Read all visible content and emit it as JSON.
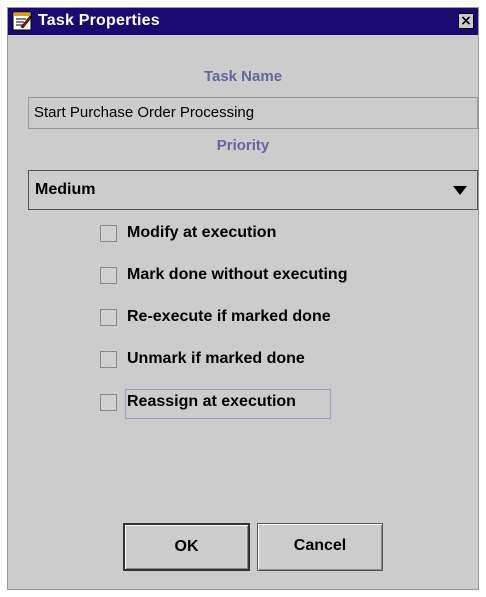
{
  "window": {
    "title": "Task Properties",
    "close_glyph": "×",
    "icon": "task-properties-icon"
  },
  "task_name": {
    "label": "Task Name",
    "value": "Start Purchase Order Processing"
  },
  "priority": {
    "label": "Priority",
    "selected": "Medium"
  },
  "options": [
    {
      "label": "Modify at execution",
      "checked": false
    },
    {
      "label": "Mark done without executing",
      "checked": false
    },
    {
      "label": "Re-execute if marked done",
      "checked": false
    },
    {
      "label": "Unmark if marked done",
      "checked": false
    },
    {
      "label": "Reassign at execution",
      "checked": false
    }
  ],
  "buttons": {
    "ok": "OK",
    "cancel": "Cancel"
  },
  "colors": {
    "titlebar": "#1a0a70",
    "dialog_bg": "#cccccc",
    "label_accent": "#66669a",
    "focus_border": "#9a9ac8"
  }
}
